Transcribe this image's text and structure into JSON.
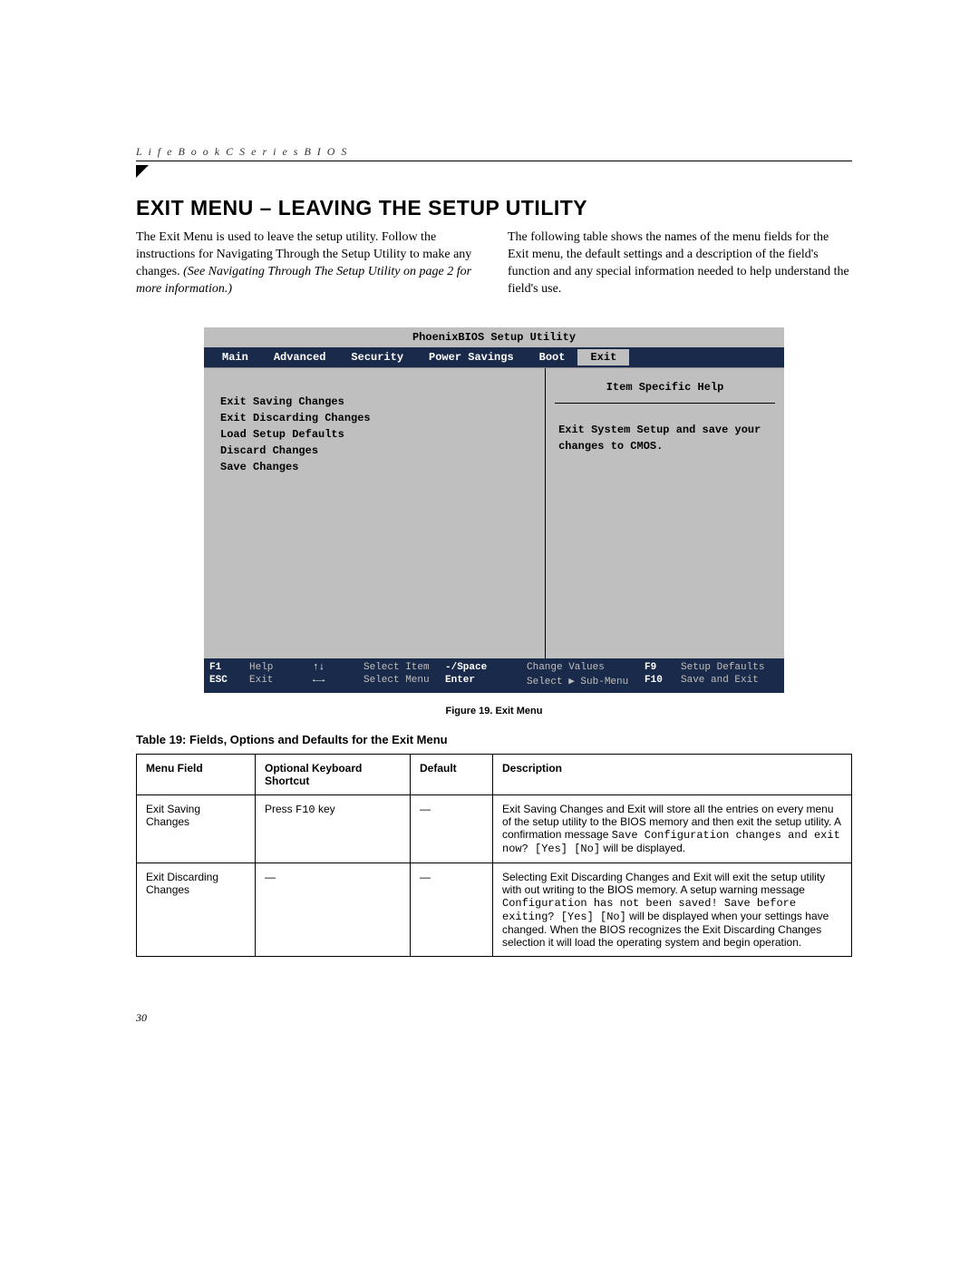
{
  "header": {
    "running_head": "L i f e B o o k   C   S e r i e s   B I O S"
  },
  "title": "EXIT MENU – LEAVING THE SETUP UTILITY",
  "intro": {
    "col1_a": "The Exit Menu is used to leave the setup utility. Follow the instructions for Navigating Through the Setup Utility to make any changes. ",
    "col1_b": "(See Navigating Through The Setup Utility on page 2 for more information.)",
    "col2": "The following table shows the names of the menu fields for the Exit menu, the default settings and a description of the field's function and any special information needed to help understand the field's use."
  },
  "bios": {
    "title": "PhoenixBIOS Setup Utility",
    "tabs": [
      "Main",
      "Advanced",
      "Security",
      "Power Savings",
      "Boot",
      "Exit"
    ],
    "active_tab": "Exit",
    "items": [
      "Exit Saving Changes",
      "Exit Discarding Changes",
      "Load Setup Defaults",
      "Discard Changes",
      "Save Changes"
    ],
    "help_title": "Item Specific Help",
    "help_body": "Exit System Setup and save your changes to CMOS.",
    "footer": {
      "r1": {
        "k1": "F1",
        "l1": "Help",
        "k2": "↑↓",
        "l2": "Select Item",
        "k3": "-/Space",
        "l3": "Change Values",
        "k4": "F9",
        "l4": "Setup Defaults"
      },
      "r2": {
        "k1": "ESC",
        "l1": "Exit",
        "k2": "←→",
        "l2": "Select Menu",
        "k3": "Enter",
        "l3": "Select ▶ Sub-Menu",
        "k4": "F10",
        "l4": "Save and Exit"
      }
    }
  },
  "figure_caption": "Figure 19.  Exit Menu",
  "table_title": "Table 19: Fields, Options and Defaults for the Exit Menu",
  "table": {
    "headers": [
      "Menu Field",
      "Optional Keyboard Shortcut",
      "Default",
      "Description"
    ],
    "rows": [
      {
        "field": "Exit Saving Changes",
        "shortcut_pre": "Press ",
        "shortcut_mono": "F10",
        "shortcut_post": " key",
        "default": "—",
        "desc_a": "Exit Saving Changes and Exit will store all the entries on every menu of the setup utility to the BIOS memory and then exit the setup utility. A confirmation message ",
        "desc_mono": "Save Configuration changes and exit now? [Yes] [No]",
        "desc_b": " will be displayed."
      },
      {
        "field": "Exit Discarding Changes",
        "shortcut_pre": "—",
        "shortcut_mono": "",
        "shortcut_post": "",
        "default": "—",
        "desc_a": "Selecting Exit Discarding Changes and Exit will exit the setup utility with out writing to the BIOS memory. A setup warning message ",
        "desc_mono": "Configuration has not been saved! Save before exiting? [Yes] [No]",
        "desc_b": " will be displayed when your settings have changed. When the BIOS recognizes the Exit Discarding Changes selection it will load the operating system and begin operation."
      }
    ]
  },
  "page_number": "30"
}
